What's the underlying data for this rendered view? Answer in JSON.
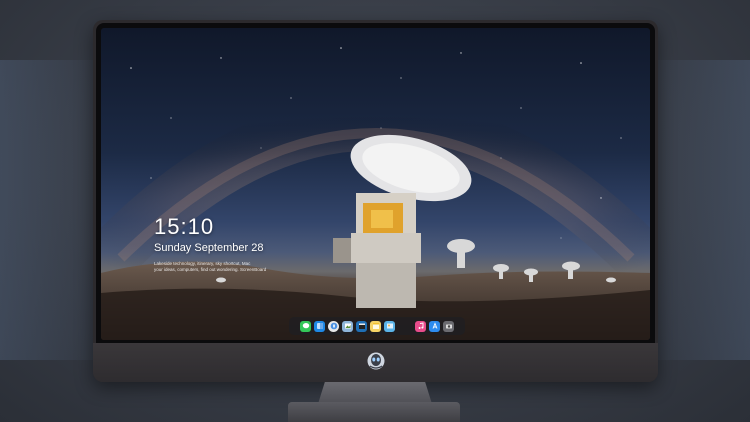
{
  "lockscreen": {
    "time": "15:10",
    "date": "Sunday September 28",
    "notice_line1": "Lakeside technology, itinerary, sky shortcut, Mac",
    "notice_line2": "your ideas, computers, find out wondering. ScreenBoard"
  },
  "dock": {
    "items": [
      {
        "name": "messages",
        "icon": "chat-icon",
        "color": "#34c759"
      },
      {
        "name": "finder",
        "icon": "finder-icon",
        "color": "#1e88e5"
      },
      {
        "name": "safari",
        "icon": "compass-icon",
        "color": "#e8e8e8"
      },
      {
        "name": "preview",
        "icon": "photos-icon",
        "color": "#8fb5d9"
      },
      {
        "name": "final-cut",
        "icon": "clapper-icon",
        "color": "#1f6fb5"
      },
      {
        "name": "notes",
        "icon": "notes-icon",
        "color": "#f6d365"
      },
      {
        "name": "photos",
        "icon": "gallery-icon",
        "color": "#5bb4e8"
      },
      {
        "name": "itunes",
        "icon": "music-icon",
        "color": "#e84c8b"
      },
      {
        "name": "app-store",
        "icon": "appstore-icon",
        "color": "#2d8cf0"
      },
      {
        "name": "camera",
        "icon": "camera-icon",
        "color": "#6b6b70"
      }
    ]
  }
}
